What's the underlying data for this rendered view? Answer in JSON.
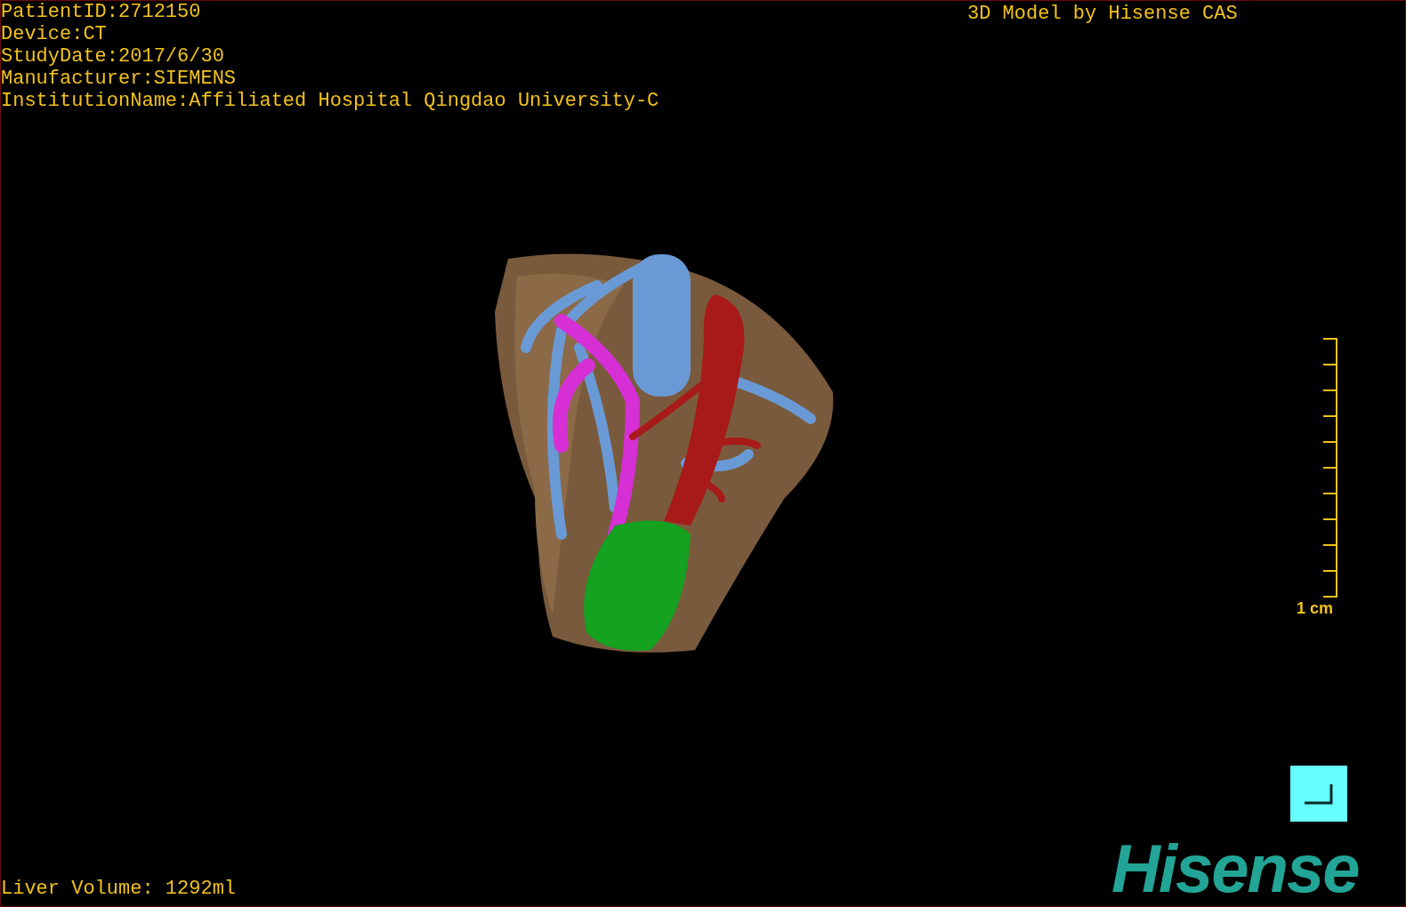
{
  "study_info": [
    "PatientID:2712150",
    "Device:CT",
    "StudyDate:2017/6/30",
    "Manufacturer:SIEMENS",
    "InstitutionName:Affiliated Hospital Qingdao University-C"
  ],
  "header_right": "3D Model by Hisense CAS",
  "scale_bar": {
    "label": "1 cm"
  },
  "liver_volume": "Liver Volume: 1292ml",
  "logo": "Hisense"
}
